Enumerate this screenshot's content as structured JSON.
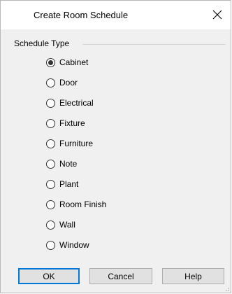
{
  "dialog": {
    "title": "Create Room Schedule",
    "close_icon": "close-icon"
  },
  "schedule_type": {
    "label": "Schedule Type",
    "selected": "Cabinet",
    "options": [
      "Cabinet",
      "Door",
      "Electrical",
      "Fixture",
      "Furniture",
      "Note",
      "Plant",
      "Room Finish",
      "Wall",
      "Window"
    ]
  },
  "buttons": {
    "ok": "OK",
    "cancel": "Cancel",
    "help": "Help"
  },
  "colors": {
    "dialog_bg": "#f0f0f0",
    "titlebar_bg": "#ffffff",
    "default_button_border": "#0078d7",
    "button_bg": "#e1e1e1"
  }
}
